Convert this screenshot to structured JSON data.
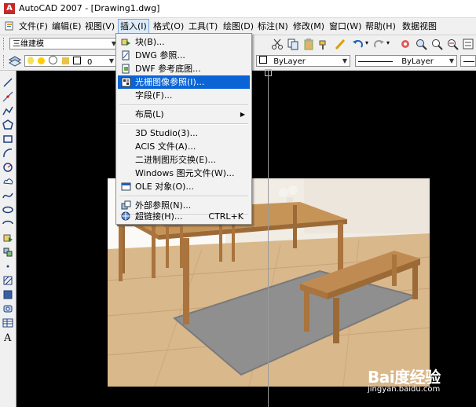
{
  "window": {
    "title": "AutoCAD 2007 - [Drawing1.dwg]"
  },
  "menubar": {
    "items": [
      {
        "label": "文件(F)"
      },
      {
        "label": "编辑(E)"
      },
      {
        "label": "视图(V)"
      },
      {
        "label": "插入(I)"
      },
      {
        "label": "格式(O)"
      },
      {
        "label": "工具(T)"
      },
      {
        "label": "绘图(D)"
      },
      {
        "label": "标注(N)"
      },
      {
        "label": "修改(M)"
      },
      {
        "label": "窗口(W)"
      },
      {
        "label": "帮助(H)"
      },
      {
        "label": "数据视图"
      }
    ],
    "active": "插入(I)"
  },
  "toolbar": {
    "workspace": "三维建模",
    "layer": "0",
    "color": "ByLayer",
    "linetype": "ByLayer"
  },
  "insert_menu": {
    "items": [
      {
        "label": "块(B)...",
        "icon": "block-icon"
      },
      {
        "label": "DWG 参照...",
        "icon": "dwg-reference-icon"
      },
      {
        "label": "DWF 参考底图...",
        "icon": "dwf-underlay-icon"
      },
      {
        "label": "光栅图像参照(I)...",
        "icon": "raster-image-icon",
        "highlighted": true
      },
      {
        "label": "字段(F)..."
      },
      {
        "label": "布局(L)",
        "submenu": true
      },
      {
        "label": "3D Studio(3)..."
      },
      {
        "label": "ACIS 文件(A)..."
      },
      {
        "label": "二进制图形交换(E)..."
      },
      {
        "label": "Windows 图元文件(W)..."
      },
      {
        "label": "OLE 对象(O)...",
        "icon": "ole-object-icon"
      },
      {
        "label": "外部参照(N)...",
        "icon": "xref-icon"
      },
      {
        "label": "超链接(H)...",
        "icon": "hyperlink-icon",
        "shortcut": "CTRL+K"
      }
    ]
  },
  "watermark": {
    "brand": "Bai度经验",
    "url": "jingyan.baidu.com"
  },
  "colors": {
    "highlight": "#0a64d6",
    "canvas": "#000000",
    "menu_bg": "#f2f2f2"
  }
}
